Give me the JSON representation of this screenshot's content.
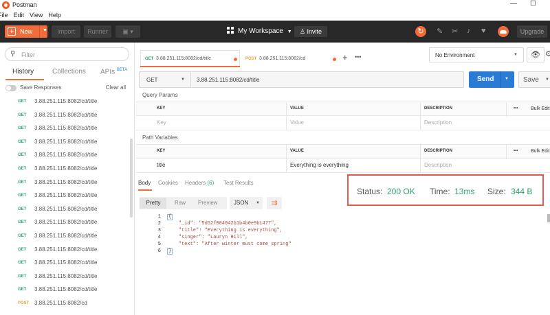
{
  "window": {
    "title": "Postman",
    "minimize": "—",
    "maximize": "☐"
  },
  "menu": [
    "File",
    "Edit",
    "View",
    "Help"
  ],
  "header": {
    "new_label": "New",
    "import_label": "Import",
    "runner_label": "Runner",
    "workspace_label": "My Workspace",
    "invite_label": "Invite",
    "upgrade_label": "Upgrade"
  },
  "sidebar": {
    "filter_placeholder": "Filter",
    "tabs": [
      "History",
      "Collections",
      "APIs"
    ],
    "beta": "BETA",
    "save_responses": "Save Responses",
    "clear_all": "Clear all",
    "history": [
      {
        "method": "GET",
        "url": "3.88.251.115:8082/cd/title"
      },
      {
        "method": "GET",
        "url": "3.88.251.115:8082/cd/title"
      },
      {
        "method": "GET",
        "url": "3.88.251.115:8082/cd/title"
      },
      {
        "method": "GET",
        "url": "3.88.251.115:8082/cd/title"
      },
      {
        "method": "GET",
        "url": "3.88.251.115:8082/cd/title"
      },
      {
        "method": "GET",
        "url": "3.88.251.115:8082/cd/title"
      },
      {
        "method": "GET",
        "url": "3.88.251.115:8082/cd/title"
      },
      {
        "method": "GET",
        "url": "3.88.251.115:8082/cd/title"
      },
      {
        "method": "GET",
        "url": "3.88.251.115:8082/cd/title"
      },
      {
        "method": "GET",
        "url": "3.88.251.115:8082/cd/title"
      },
      {
        "method": "GET",
        "url": "3.88.251.115:8082/cd/title"
      },
      {
        "method": "GET",
        "url": "3.88.251.115:8082/cd/title"
      },
      {
        "method": "GET",
        "url": "3.88.251.115:8082/cd/title"
      },
      {
        "method": "GET",
        "url": "3.88.251.115:8082/cd/title"
      },
      {
        "method": "GET",
        "url": "3.88.251.115:8082/cd/title"
      },
      {
        "method": "POST",
        "url": "3.88.251.115:8082/cd"
      }
    ]
  },
  "request_tabs": [
    {
      "method": "GET",
      "url": "3.88.251.115:8082/cd/title"
    },
    {
      "method": "POST",
      "url": "3.88.251.115:8082/cd"
    }
  ],
  "environment": "No Environment",
  "request": {
    "method": "GET",
    "url": "3.88.251.115:8082/cd/title",
    "send_label": "Send",
    "save_label": "Save"
  },
  "query_params": {
    "title": "Query Params",
    "headers": [
      "KEY",
      "VALUE",
      "DESCRIPTION"
    ],
    "more": "•••",
    "bulk_edit": "Bulk Edit",
    "placeholders": [
      "Key",
      "Value",
      "Description"
    ]
  },
  "path_variables": {
    "title": "Path Variables",
    "headers": [
      "KEY",
      "VALUE",
      "DESCRIPTION"
    ],
    "more": "•••",
    "bulk_edit": "Bulk Edit",
    "row": {
      "key": "title",
      "value": "Everything is everything",
      "description_placeholder": "Description"
    }
  },
  "response": {
    "tabs": [
      "Body",
      "Cookies",
      "Headers (6)",
      "Test Results"
    ],
    "status_label": "Status:",
    "status_value": "200 OK",
    "time_label": "Time:",
    "time_value": "13ms",
    "size_label": "Size:",
    "size_value": "344 B",
    "views": [
      "Pretty",
      "Raw",
      "Preview"
    ],
    "format": "JSON",
    "code_lines": [
      "{",
      "    \"_id\": \"5d52f004042b1b4b0e9b1477\",",
      "    \"title\": \"Everything is everything\",",
      "    \"singer\": \"Lauryn Hill\",",
      "    \"text\": \"After winter must come spring\"",
      "}"
    ],
    "line_numbers": [
      "1",
      "2",
      "3",
      "4",
      "5",
      "6"
    ]
  },
  "colors": {
    "accent": "#f26b3a",
    "get": "#2fa36b",
    "post": "#e8a33d",
    "send": "#2a7bd4",
    "status_ok": "#2fa36b",
    "highlight_box": "#e05a4f"
  }
}
